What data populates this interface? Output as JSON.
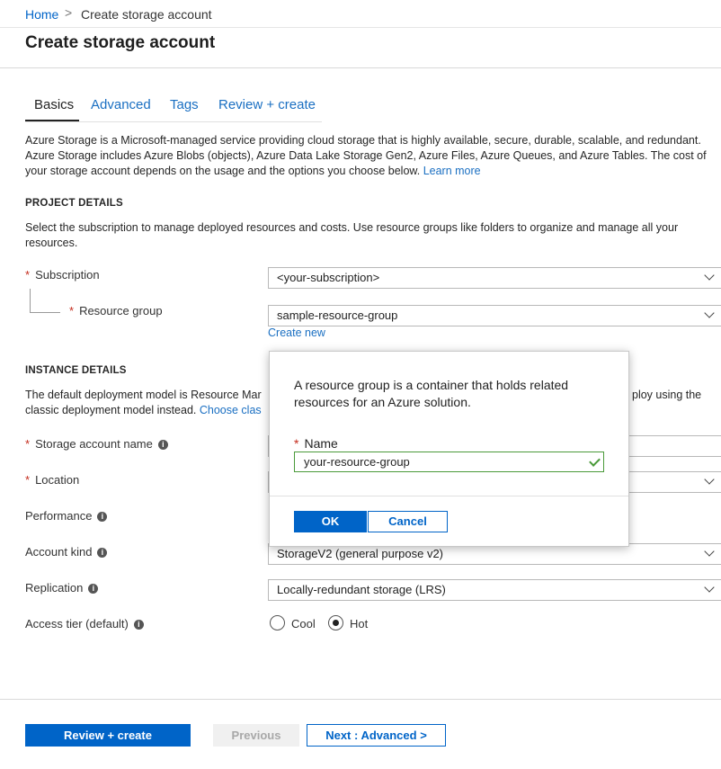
{
  "breadcrumb": {
    "home": "Home",
    "separator": ">",
    "current": "Create storage account"
  },
  "page_title": "Create storage account",
  "tabs": [
    {
      "label": "Basics",
      "active": true
    },
    {
      "label": "Advanced"
    },
    {
      "label": "Tags"
    },
    {
      "label": "Review + create"
    }
  ],
  "intro": {
    "text": "Azure Storage is a Microsoft-managed service providing cloud storage that is highly available, secure, durable, scalable, and redundant. Azure Storage includes Azure Blobs (objects), Azure Data Lake Storage Gen2, Azure Files, Azure Queues, and Azure Tables. The cost of your storage account depends on the usage and the options you choose below.",
    "learn_more": "Learn more"
  },
  "project_details": {
    "heading": "PROJECT DETAILS",
    "description": "Select the subscription to manage deployed resources and costs. Use resource groups like folders to organize and manage all your resources.",
    "subscription_label": "Subscription",
    "subscription_value": "<your-subscription>",
    "resource_group_label": "Resource group",
    "resource_group_value": "sample-resource-group",
    "create_new": "Create new"
  },
  "instance_details": {
    "heading": "INSTANCE DETAILS",
    "description_start": "The default deployment model is Resource Mar",
    "description_end": "ploy using the",
    "description_line2": "classic deployment model instead.",
    "choose_classic": "Choose clas",
    "storage_account_name_label": "Storage account name",
    "location_label": "Location",
    "performance_label": "Performance",
    "account_kind_label": "Account kind",
    "account_kind_value": "StorageV2 (general purpose v2)",
    "replication_label": "Replication",
    "replication_value": "Locally-redundant storage (LRS)",
    "access_tier_label": "Access tier (default)",
    "access_tier_options": [
      {
        "label": "Cool",
        "selected": false
      },
      {
        "label": "Hot",
        "selected": true
      }
    ]
  },
  "dialog": {
    "description": "A resource group is a container that holds related resources for an Azure solution.",
    "name_label": "Name",
    "name_value": "your-resource-group",
    "ok": "OK",
    "cancel": "Cancel"
  },
  "footer": {
    "review_create": "Review + create",
    "previous": "Previous",
    "next": "Next : Advanced >"
  },
  "colors": {
    "accent": "#0064c8",
    "link": "#1a6fc2",
    "required": "#c42b1c",
    "valid": "#4a9a3a"
  },
  "icons": {
    "info": "info-icon",
    "dropdown": "chevron-down-icon",
    "valid": "checkmark-icon"
  }
}
